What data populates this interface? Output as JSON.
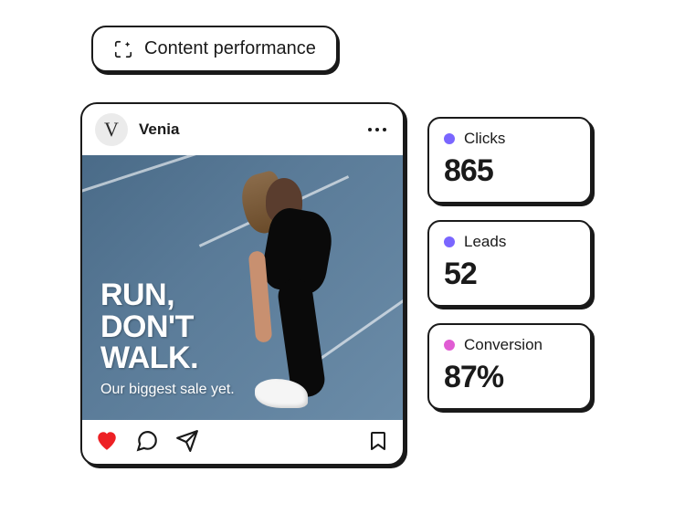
{
  "pill": {
    "label": "Content performance"
  },
  "post": {
    "brand_initial": "V",
    "brand_name": "Venia",
    "headline": "RUN,\nDON'T\nWALK.",
    "subline": "Our biggest sale yet."
  },
  "metrics": [
    {
      "label": "Clicks",
      "value": "865",
      "color": "#7a66ff",
      "style": "heavy"
    },
    {
      "label": "Leads",
      "value": "52",
      "color": "#7a66ff",
      "style": "light"
    },
    {
      "label": "Conversion",
      "value": "87%",
      "color": "#e05cd3",
      "style": "heavy"
    }
  ],
  "colors": {
    "heart": "#ed2024"
  }
}
